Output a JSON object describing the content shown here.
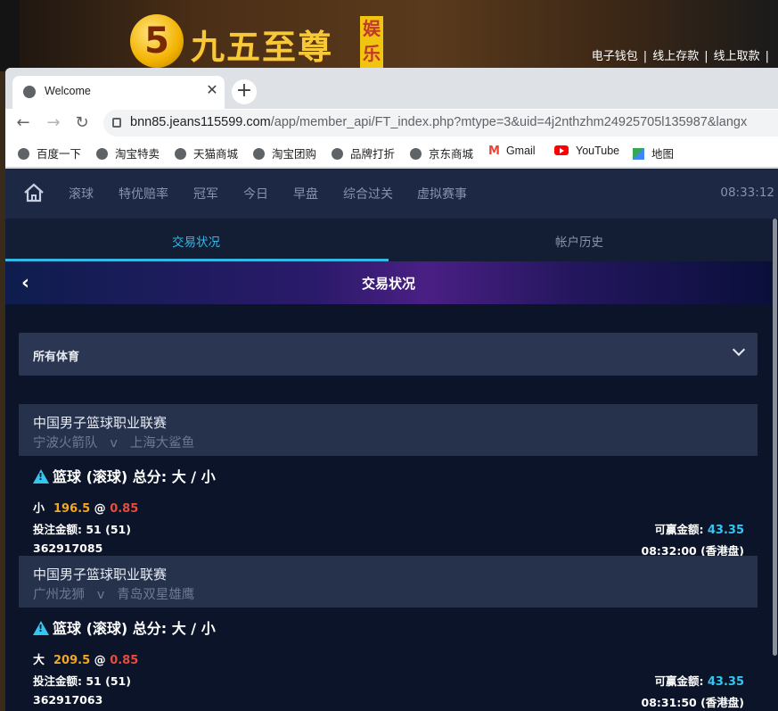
{
  "site": {
    "logo_numeral": "5",
    "logo_text": "九五至尊",
    "logo_badge": "娱乐城",
    "links": [
      "电子钱包",
      "线上存款",
      "线上取款"
    ]
  },
  "browser": {
    "tab_title": "Welcome",
    "url_host": "bnn85.jeans115599.com",
    "url_path": "/app/member_api/FT_index.php?mtype=3&uid=4j2nthzhm24925705l135987&langx",
    "bookmarks": [
      "百度一下",
      "淘宝特卖",
      "天猫商城",
      "淘宝团购",
      "品牌打折",
      "京东商城",
      "Gmail",
      "YouTube",
      "地图"
    ]
  },
  "nav": {
    "items": [
      "滚球",
      "特优赔率",
      "冠军",
      "今日",
      "早盘",
      "综合过关",
      "虚拟赛事"
    ],
    "clock": "08:33:12"
  },
  "tabs": {
    "active": "交易状况",
    "inactive": "帐户历史"
  },
  "hero_title": "交易状况",
  "filter": {
    "label": "所有体育"
  },
  "bets": [
    {
      "league": "中国男子篮球职业联赛",
      "home": "宁波火箭队",
      "vs": "v",
      "away": "上海大鲨鱼",
      "market": "篮球 (滚球) 总分: 大 / 小",
      "pick": "小",
      "line": "196.5",
      "at": "@",
      "odds": "0.85",
      "stake_label": "投注金额:",
      "stake": "51 (51)",
      "win_label": "可赢金额:",
      "win": "43.35",
      "ticket": "362917085",
      "time": "08:32:00 (香港盘)"
    },
    {
      "league": "中国男子篮球职业联赛",
      "home": "广州龙狮",
      "vs": "v",
      "away": "青岛双星雄鹰",
      "market": "篮球 (滚球) 总分: 大 / 小",
      "pick": "大",
      "line": "209.5",
      "at": "@",
      "odds": "0.85",
      "stake_label": "投注金额:",
      "stake": "51 (51)",
      "win_label": "可赢金额:",
      "win": "43.35",
      "ticket": "362917063",
      "time": "08:31:50 (香港盘)"
    }
  ],
  "colors": {
    "accent_cyan": "#35b8e6",
    "line_orange": "#f5a623",
    "odds_red": "#e74c3c",
    "page_bg": "#0b1428"
  }
}
